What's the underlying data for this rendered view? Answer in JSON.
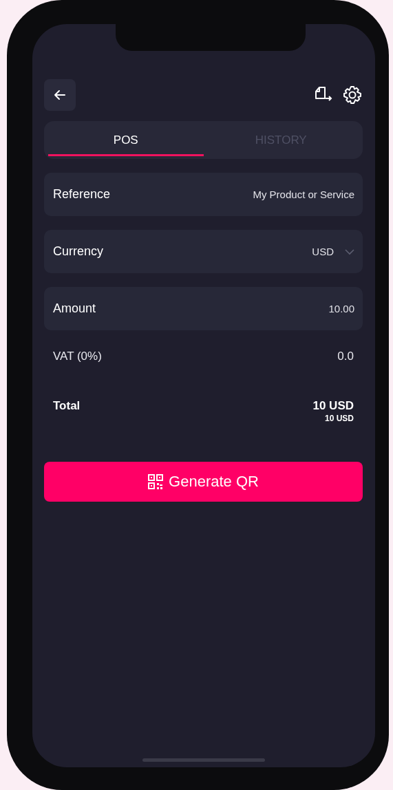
{
  "tabs": [
    {
      "label": "POS",
      "selected": true
    },
    {
      "label": "HISTORY",
      "selected": false
    }
  ],
  "fields": [
    {
      "kind": "text",
      "label": "Reference",
      "value": "My Product or Service"
    },
    {
      "kind": "select",
      "label": "Currency",
      "value": "USD"
    },
    {
      "kind": "text",
      "label": "Amount",
      "value": "10.00"
    }
  ],
  "vat": {
    "label": "VAT (0%)",
    "value": "0.0"
  },
  "total": {
    "label": "Total",
    "value": "10 USD",
    "secondary": "10 USD"
  },
  "button": {
    "label": "Generate QR"
  }
}
